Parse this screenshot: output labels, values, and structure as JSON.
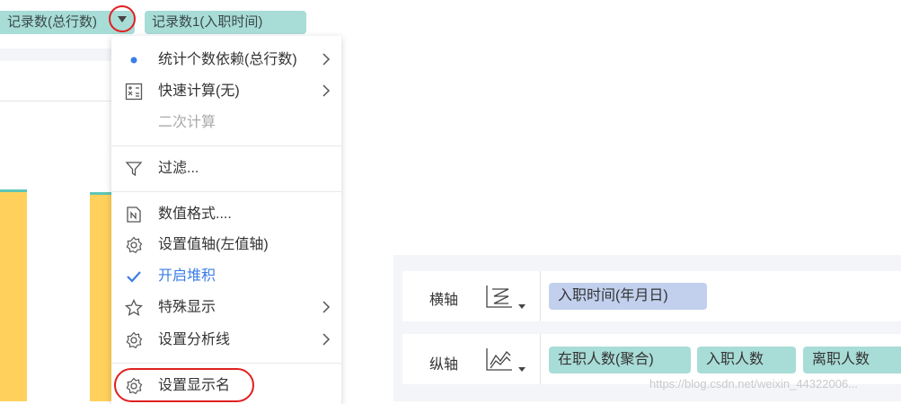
{
  "top_chips": {
    "chip1": "记录数(总行数)",
    "chip2": "记录数1(入职时间)"
  },
  "menu": {
    "items": [
      {
        "label": "统计个数依赖(总行数)",
        "icon": "bullet-dot-icon",
        "submenu": true
      },
      {
        "label": "快速计算(无)",
        "icon": "calculator-icon",
        "submenu": true
      },
      {
        "label": "二次计算",
        "icon": "",
        "submenu": false,
        "disabled": true
      },
      {
        "label": "过滤...",
        "icon": "filter-icon",
        "submenu": false
      },
      {
        "label": "数值格式....",
        "icon": "number-format-icon",
        "submenu": false
      },
      {
        "label": "设置值轴(左值轴)",
        "icon": "gear-icon",
        "submenu": false
      },
      {
        "label": "开启堆积",
        "icon": "check-icon",
        "submenu": false,
        "checked": true
      },
      {
        "label": "特殊显示",
        "icon": "star-icon",
        "submenu": true
      },
      {
        "label": "设置分析线",
        "icon": "gear-icon",
        "submenu": true
      },
      {
        "label": "设置显示名",
        "icon": "gear-icon",
        "submenu": false
      }
    ]
  },
  "panel": {
    "x_axis": {
      "label": "横轴",
      "icon": "chart-type-icon",
      "chips": [
        "入职时间(年月日)"
      ]
    },
    "y_axis": {
      "label": "纵轴",
      "icon": "line-chart-icon",
      "chips": [
        "在职人数(聚合)",
        "入职人数",
        "离职人数"
      ]
    }
  },
  "watermark": "https://blog.csdn.net/weixin_44322006...",
  "colors": {
    "chip_teal": "#a8dcd7",
    "chip_blue": "#c2d0ee",
    "bar_yellow": "#ffd15c",
    "highlight_red": "#e02020",
    "accent_blue": "#3a7ee6"
  }
}
